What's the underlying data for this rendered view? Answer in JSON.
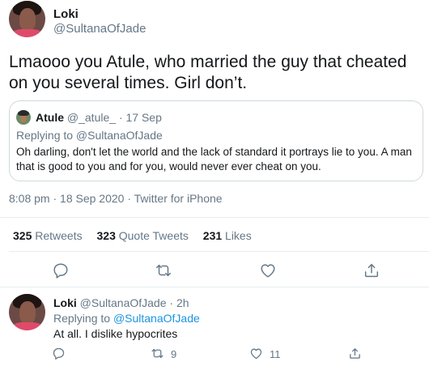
{
  "main_tweet": {
    "author_name": "Loki",
    "author_handle": "@SultanaOfJade",
    "text": "Lmaooo you Atule, who married the guy that cheated on you several times. Girl don’t.",
    "quoted": {
      "author_name": "Atule",
      "author_handle": "@_atule_",
      "dot": "·",
      "date": "17 Sep",
      "replying_to": "Replying to @SultanaOfJade",
      "text": "Oh darling, don't let the world and the lack of standard it portrays lie to you. A man that is good to you and for you, would never ever cheat on you."
    },
    "meta": "8:08 pm · 18 Sep 2020 · Twitter for iPhone",
    "stats": {
      "retweets_count": "325",
      "retweets_label": "Retweets",
      "quotes_count": "323",
      "quotes_label": "Quote Tweets",
      "likes_count": "231",
      "likes_label": "Likes"
    },
    "actions": [
      "reply-icon",
      "retweet-icon",
      "like-icon",
      "share-icon"
    ]
  },
  "reply_tweet": {
    "author_name": "Loki",
    "author_handle": "@SultanaOfJade",
    "dot": "·",
    "time": "2h",
    "replying_to_prefix": "Replying to",
    "replying_to_handle": "@SultanaOfJade",
    "text": "At all. I dislike hypocrites",
    "retweet_count": "9",
    "like_count": "11"
  },
  "colors": {
    "link": "#1b95e0",
    "muted": "#657786",
    "text": "#14171a",
    "divider": "#e6ecf0"
  }
}
